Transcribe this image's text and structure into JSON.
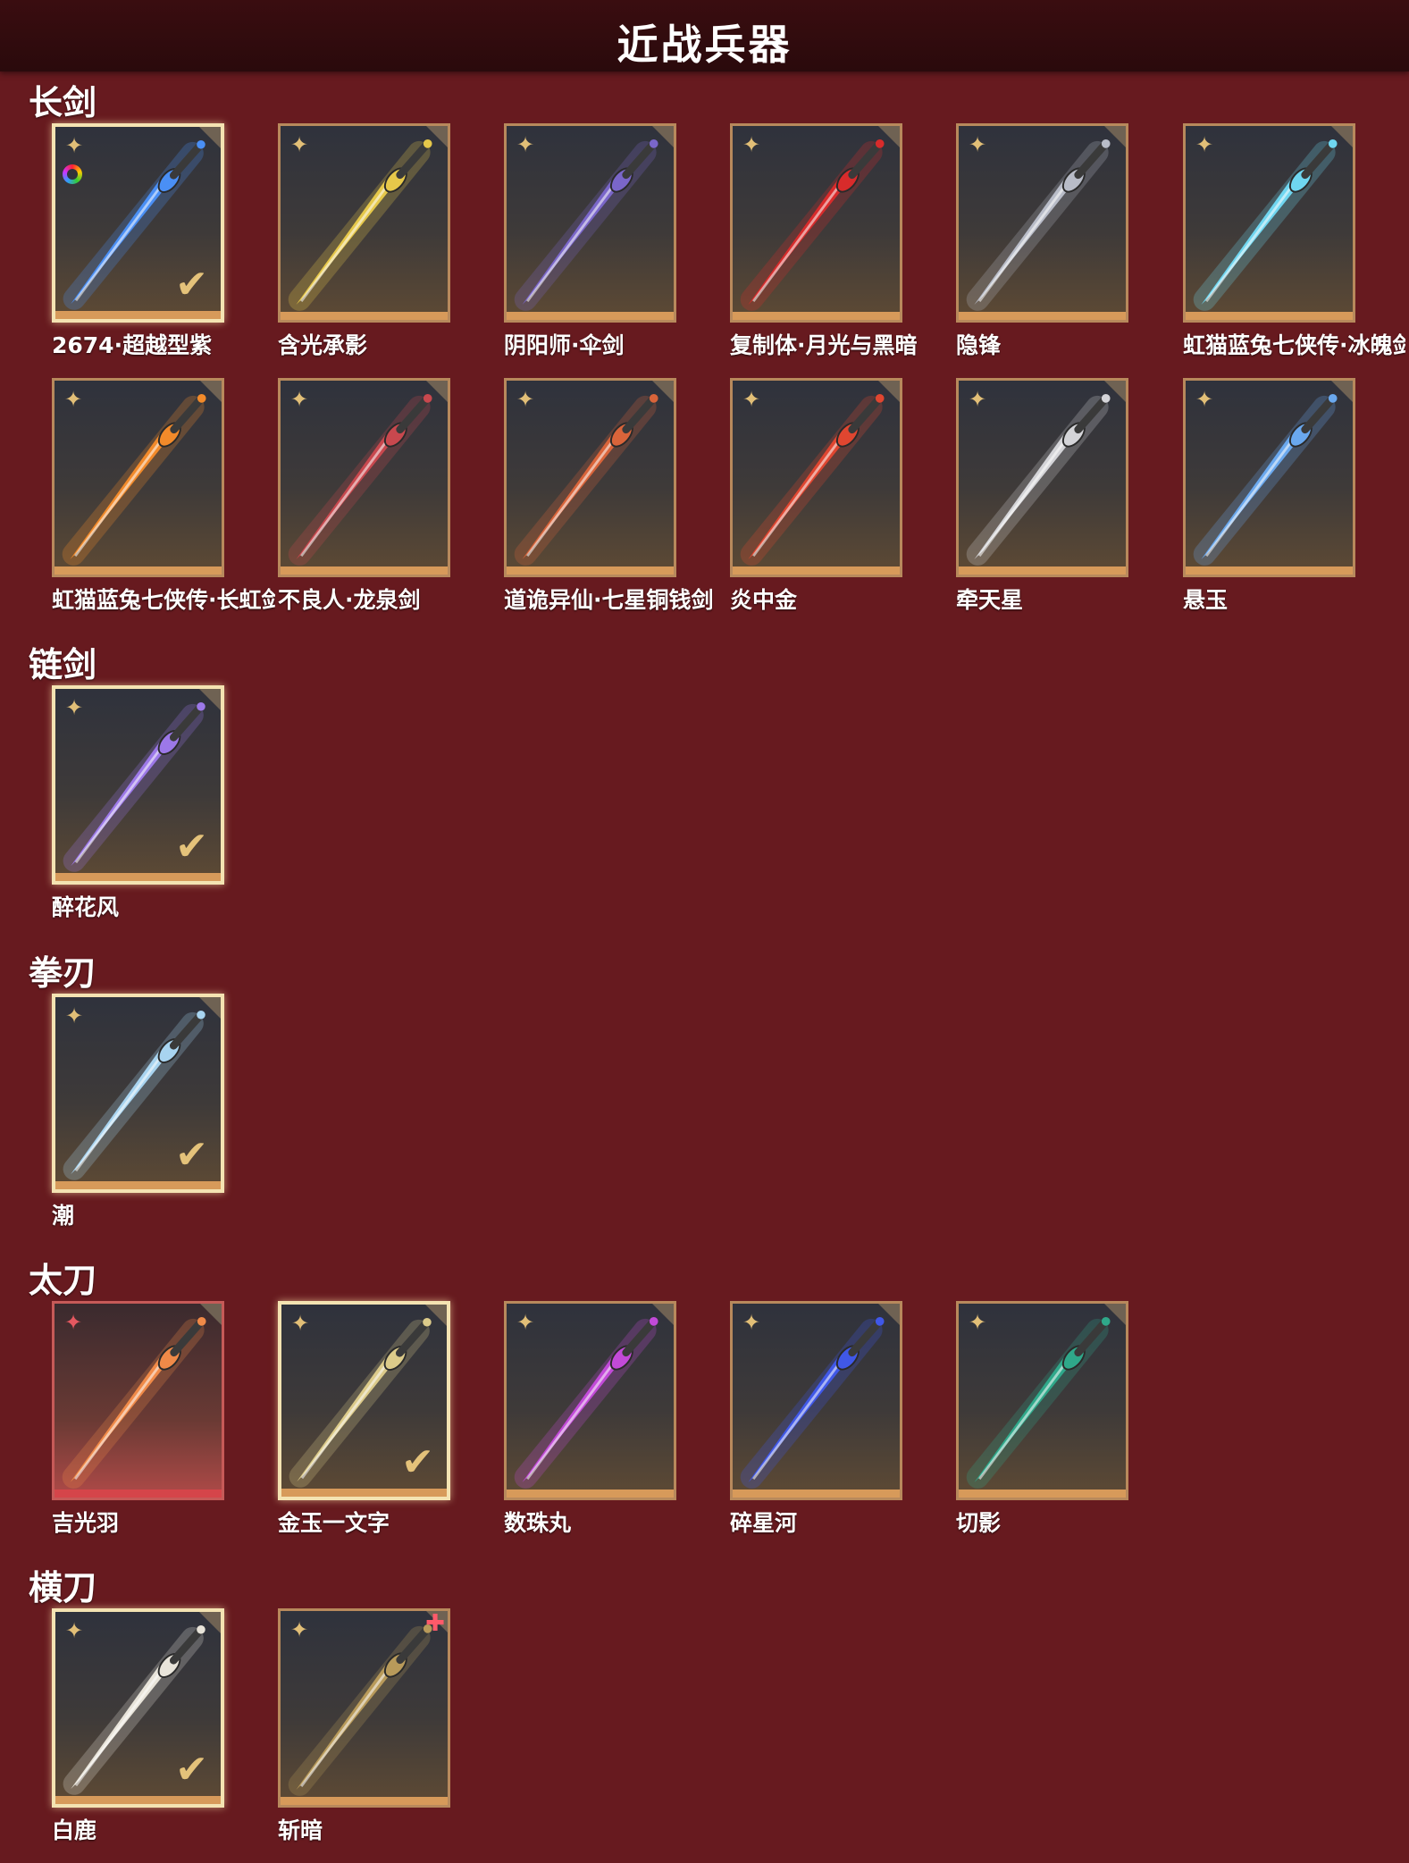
{
  "header": {
    "title": "近战兵器"
  },
  "sections": [
    {
      "title": "长剑",
      "items": [
        {
          "name": "2674·超越型紫",
          "accent": "#4a8ff5",
          "equipped": true,
          "rainbow": true
        },
        {
          "name": "含光承影",
          "accent": "#e6c84a"
        },
        {
          "name": "阴阳师·伞剑",
          "accent": "#7a66c9"
        },
        {
          "name": "复制体·月光与黑暗",
          "accent": "#d82b2b"
        },
        {
          "name": "隐锋",
          "accent": "#b8bcc8"
        },
        {
          "name": "虹猫蓝兔七侠传·冰魄剑",
          "accent": "#6fd6f0"
        },
        {
          "name": "虹猫蓝兔七侠传·长虹剑",
          "accent": "#f28a2a"
        },
        {
          "name": "不良人·龙泉剑",
          "accent": "#c8484e"
        },
        {
          "name": "道诡异仙·七星铜钱剑",
          "accent": "#d9643a"
        },
        {
          "name": "炎中金",
          "accent": "#e04630"
        },
        {
          "name": "牵天星",
          "accent": "#d4d4d8"
        },
        {
          "name": "悬玉",
          "accent": "#6aa8ee"
        }
      ]
    },
    {
      "title": "链剑",
      "items": [
        {
          "name": "醉花风",
          "accent": "#9c78e8",
          "equipped": true
        }
      ]
    },
    {
      "title": "拳刃",
      "items": [
        {
          "name": "潮",
          "accent": "#a8d4f0",
          "equipped": true
        }
      ]
    },
    {
      "title": "太刀",
      "items": [
        {
          "name": "吉光羽",
          "accent": "#f08a48",
          "red": true
        },
        {
          "name": "金玉一文字",
          "accent": "#dccb8a",
          "equipped": true
        },
        {
          "name": "数珠丸",
          "accent": "#c24ad8"
        },
        {
          "name": "碎星河",
          "accent": "#4058e8"
        },
        {
          "name": "切影",
          "accent": "#2fa88a"
        }
      ]
    },
    {
      "title": "横刀",
      "items": [
        {
          "name": "白鹿",
          "accent": "#e8e4da",
          "equipped": true
        },
        {
          "name": "斩暗",
          "accent": "#b89a5a",
          "newtag": true
        }
      ]
    }
  ],
  "icons": {
    "rarity": "star-flower-icon",
    "equipped": "check-icon"
  }
}
